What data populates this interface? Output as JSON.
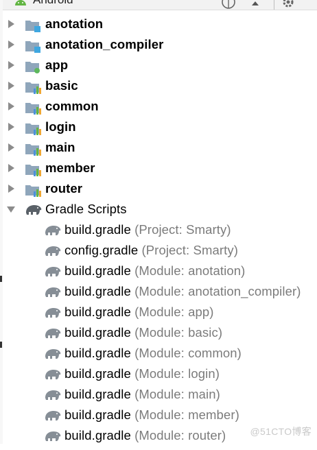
{
  "panel": {
    "title": "Android",
    "icons": [
      "android-icon",
      "globe-icon",
      "collapse-icon",
      "gear-icon"
    ]
  },
  "modules": [
    {
      "name": "anotation",
      "icon": "java-module-icon"
    },
    {
      "name": "anotation_compiler",
      "icon": "java-module-icon"
    },
    {
      "name": "app",
      "icon": "app-module-icon"
    },
    {
      "name": "basic",
      "icon": "android-library-icon"
    },
    {
      "name": "common",
      "icon": "android-library-icon"
    },
    {
      "name": "login",
      "icon": "android-library-icon"
    },
    {
      "name": "main",
      "icon": "android-library-icon"
    },
    {
      "name": "member",
      "icon": "android-library-icon"
    },
    {
      "name": "router",
      "icon": "android-library-icon"
    }
  ],
  "gradle_scripts": {
    "label": "Gradle Scripts",
    "expanded": true,
    "files": [
      {
        "file": "build.gradle",
        "desc": "(Project: Smarty)"
      },
      {
        "file": "config.gradle",
        "desc": "(Project: Smarty)"
      },
      {
        "file": "build.gradle",
        "desc": "(Module: anotation)"
      },
      {
        "file": "build.gradle",
        "desc": "(Module: anotation_compiler)"
      },
      {
        "file": "build.gradle",
        "desc": "(Module: app)"
      },
      {
        "file": "build.gradle",
        "desc": "(Module: basic)"
      },
      {
        "file": "build.gradle",
        "desc": "(Module: common)"
      },
      {
        "file": "build.gradle",
        "desc": "(Module: login)"
      },
      {
        "file": "build.gradle",
        "desc": "(Module: main)"
      },
      {
        "file": "build.gradle",
        "desc": "(Module: member)"
      },
      {
        "file": "build.gradle",
        "desc": "(Module: router)"
      }
    ]
  },
  "watermark": "@51CTO博客",
  "colors": {
    "arrow": "#8c8c8c",
    "folder": "#8fa6bb",
    "java_badge": "#3fa7e0",
    "app_badge": "#5db85c",
    "lib_bars": [
      "#4a90d9",
      "#62b543",
      "#f0a732"
    ],
    "gradle_icon": "#868e96",
    "desc_text": "#7b7b7b"
  }
}
